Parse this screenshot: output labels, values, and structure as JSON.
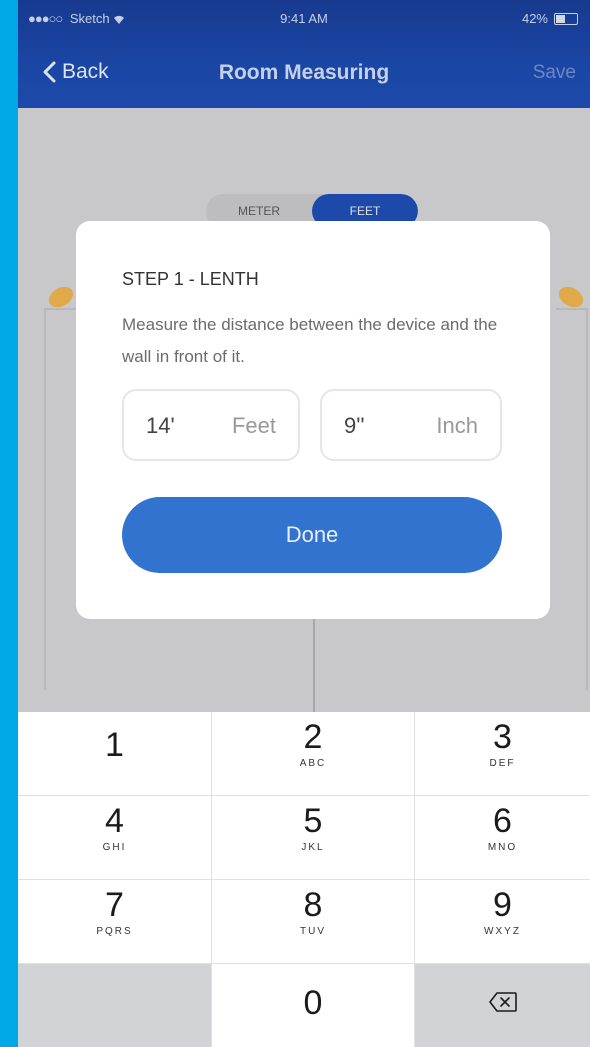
{
  "status_bar": {
    "signal_dots": "●●●○○",
    "carrier": "Sketch",
    "time": "9:41 AM",
    "battery_percent": "42%"
  },
  "nav": {
    "back_label": "Back",
    "title": "Room Measuring",
    "save_label": "Save"
  },
  "background": {
    "unit_toggle": {
      "meter_label": "METER",
      "feet_label": "FEET",
      "selected": "FEET"
    }
  },
  "dialog": {
    "title": "STEP 1 - LENTH",
    "description": "Measure the distance between the device and the wall in front of it.",
    "feet_value": "14'",
    "feet_unit": "Feet",
    "inch_value": "9''",
    "inch_unit": "Inch",
    "done_label": "Done"
  },
  "keypad": {
    "keys": [
      {
        "digit": "1",
        "letters": ""
      },
      {
        "digit": "2",
        "letters": "ABC"
      },
      {
        "digit": "3",
        "letters": "DEF"
      },
      {
        "digit": "4",
        "letters": "GHI"
      },
      {
        "digit": "5",
        "letters": "JKL"
      },
      {
        "digit": "6",
        "letters": "MNO"
      },
      {
        "digit": "7",
        "letters": "PQRS"
      },
      {
        "digit": "8",
        "letters": "TUV"
      },
      {
        "digit": "9",
        "letters": "WXYZ"
      },
      {
        "digit": "",
        "letters": ""
      },
      {
        "digit": "0",
        "letters": ""
      },
      {
        "digit": "delete-icon",
        "letters": ""
      }
    ]
  },
  "colors": {
    "nav_bar": "#1a45a3",
    "done_button": "#3273cf",
    "outer_background": "#00a9e6",
    "marker_accent": "#e0a94a"
  }
}
